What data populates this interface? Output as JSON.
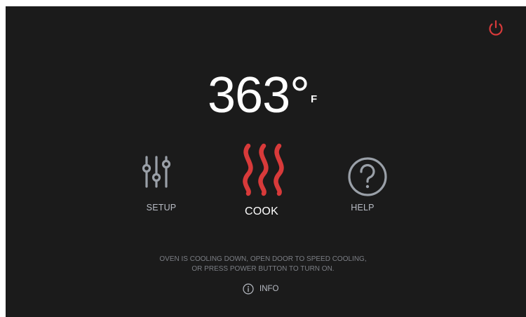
{
  "header": {
    "power_icon": "power-icon",
    "power_color": "#d63a3a"
  },
  "temperature": {
    "value": "363°",
    "unit": "F"
  },
  "modes": {
    "setup": {
      "label": "SETUP",
      "icon": "sliders-icon"
    },
    "cook": {
      "label": "COOK",
      "icon": "heat-waves-icon",
      "color": "#d83a3a",
      "active": true
    },
    "help": {
      "label": "HELP",
      "icon": "question-circle-icon"
    }
  },
  "status": {
    "line1": "OVEN IS COOLING DOWN, OPEN DOOR TO SPEED COOLING,",
    "line2": "OR PRESS POWER BUTTON TO TURN ON."
  },
  "info": {
    "label": "INFO",
    "icon": "info-icon"
  }
}
